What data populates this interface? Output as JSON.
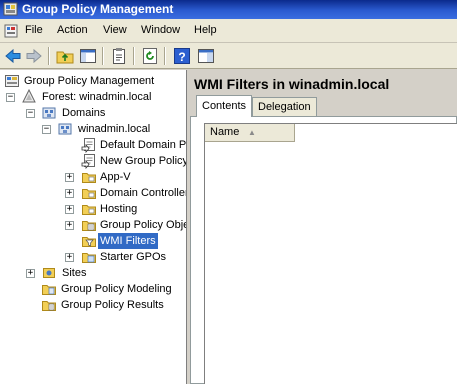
{
  "window": {
    "title": "Group Policy Management"
  },
  "menu": [
    "File",
    "Action",
    "View",
    "Window",
    "Help"
  ],
  "toolbar": {
    "buttons": [
      "back-icon",
      "forward-icon",
      "up-folder-icon",
      "show-hide-tree-icon",
      "properties-icon",
      "refresh-icon",
      "help-icon",
      "console-icon"
    ]
  },
  "tree": {
    "root": "Group Policy Management",
    "forest": "Forest: winadmin.local",
    "domains": "Domains",
    "domain": "winadmin.local",
    "items": [
      "Default Domain Po",
      "New Group Policy",
      "App-V",
      "Domain Controller",
      "Hosting",
      "Group Policy Obje",
      "WMI Filters",
      "Starter GPOs"
    ],
    "sites": "Sites",
    "modeling": "Group Policy Modeling",
    "results": "Group Policy Results"
  },
  "right": {
    "heading": "WMI Filters in winadmin.local",
    "tabs": [
      "Contents",
      "Delegation"
    ],
    "columns": [
      "Name"
    ]
  }
}
